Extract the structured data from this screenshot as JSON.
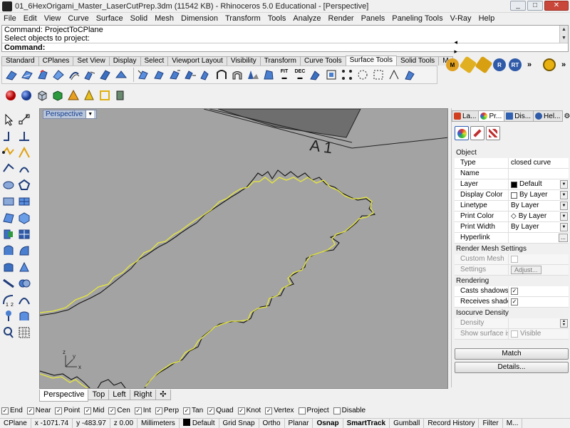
{
  "window": {
    "title": "01_6HexOrigami_Master_LaserCutPrep.3dm (11542 KB) - Rhinoceros 5.0 Educational - [Perspective]",
    "minimize": "_",
    "maximize": "□",
    "close": "✕"
  },
  "menubar": [
    "File",
    "Edit",
    "View",
    "Curve",
    "Surface",
    "Solid",
    "Mesh",
    "Dimension",
    "Transform",
    "Tools",
    "Analyze",
    "Render",
    "Panels",
    "Paneling Tools",
    "V-Ray",
    "Help"
  ],
  "command": {
    "history": [
      "Command: ProjectToCPlane",
      "Select objects to project:"
    ],
    "prompt": "Command:"
  },
  "toolbar_tabs": {
    "tabs": [
      "Standard",
      "CPlanes",
      "Set View",
      "Display",
      "Select",
      "Viewport Layout",
      "Visibility",
      "Transform",
      "Curve Tools",
      "Surface Tools",
      "Solid Tools",
      "M"
    ],
    "active": "Surface Tools",
    "arrows": "◂ ▸ ▪"
  },
  "toolbar_right": {
    "rt_label": "RT",
    "r_label": "R",
    "m_label": "M",
    "chevron": "»"
  },
  "toolbar_text_icons": {
    "fit": "FIT",
    "dec": "DEC"
  },
  "viewport": {
    "title": "Perspective",
    "label_in_scene": "A 1",
    "axis_x": "x",
    "axis_y": "y",
    "axis_z": "z"
  },
  "viewport_tabs": [
    "Perspective",
    "Top",
    "Left",
    "Right"
  ],
  "viewport_tab_add": "✣",
  "right_panel": {
    "tabs": [
      "La...",
      "Pr...",
      "Dis...",
      "Hel..."
    ],
    "active_tab": "Pr...",
    "sections": {
      "object": "Object",
      "render_mesh": "Render Mesh Settings",
      "rendering": "Rendering",
      "isocurve": "Isocurve Density"
    },
    "props": {
      "type": {
        "label": "Type",
        "value": "closed curve"
      },
      "name": {
        "label": "Name",
        "value": ""
      },
      "layer": {
        "label": "Layer",
        "value": "Default"
      },
      "display_color": {
        "label": "Display Color",
        "value": "By Layer"
      },
      "linetype": {
        "label": "Linetype",
        "value": "By Layer"
      },
      "print_color": {
        "label": "Print Color",
        "value": "By Layer"
      },
      "print_width": {
        "label": "Print Width",
        "value": "By Layer"
      },
      "hyperlink": {
        "label": "Hyperlink",
        "value": "..."
      }
    },
    "render_mesh": {
      "custom_mesh": "Custom Mesh",
      "settings": "Settings",
      "adjust": "Adjust..."
    },
    "rendering": {
      "casts_shadows": "Casts shadows",
      "receives_shadows": "Receives shado..."
    },
    "isocurve": {
      "density": "Density",
      "show_surface": "Show surface is...",
      "visible": "Visible"
    },
    "match_button": "Match",
    "details_button": "Details..."
  },
  "osnaps": [
    {
      "label": "End",
      "checked": true
    },
    {
      "label": "Near",
      "checked": true
    },
    {
      "label": "Point",
      "checked": true
    },
    {
      "label": "Mid",
      "checked": true
    },
    {
      "label": "Cen",
      "checked": true
    },
    {
      "label": "Int",
      "checked": true
    },
    {
      "label": "Perp",
      "checked": true
    },
    {
      "label": "Tan",
      "checked": true
    },
    {
      "label": "Quad",
      "checked": true
    },
    {
      "label": "Knot",
      "checked": true
    },
    {
      "label": "Vertex",
      "checked": true
    },
    {
      "label": "Project",
      "checked": false
    },
    {
      "label": "Disable",
      "checked": false
    }
  ],
  "statusbar": {
    "cplane": "CPlane",
    "x": "x -1071.74",
    "y": "y -483.97",
    "z": "z 0.00",
    "units": "Millimeters",
    "layer": "Default",
    "grid_snap": "Grid Snap",
    "ortho": "Ortho",
    "planar": "Planar",
    "osnap": "Osnap",
    "smarttrack": "SmartTrack",
    "gumball": "Gumball",
    "record_history": "Record History",
    "filter": "Filter",
    "more": "M..."
  },
  "colors": {
    "viewport_bg": "#a3a3a3",
    "curve_black": "#111111",
    "curve_yellow": "#e8e83a",
    "accent_blue": "#103a8c"
  }
}
